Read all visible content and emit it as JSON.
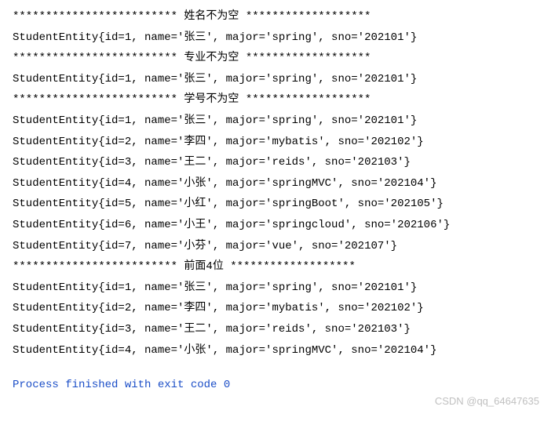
{
  "lines": [
    "*************************  姓名不为空  *******************",
    "StudentEntity{id=1, name='张三', major='spring', sno='202101'}",
    "*************************  专业不为空  *******************",
    "StudentEntity{id=1, name='张三', major='spring', sno='202101'}",
    "*************************  学号不为空  *******************",
    "StudentEntity{id=1, name='张三', major='spring', sno='202101'}",
    "StudentEntity{id=2, name='李四', major='mybatis', sno='202102'}",
    "StudentEntity{id=3, name='王二', major='reids', sno='202103'}",
    "StudentEntity{id=4, name='小张', major='springMVC', sno='202104'}",
    "StudentEntity{id=5, name='小红', major='springBoot', sno='202105'}",
    "StudentEntity{id=6, name='小王', major='springcloud', sno='202106'}",
    "StudentEntity{id=7, name='小芬', major='vue', sno='202107'}",
    "*************************  前面4位  *******************",
    "StudentEntity{id=1, name='张三', major='spring', sno='202101'}",
    "StudentEntity{id=2, name='李四', major='mybatis', sno='202102'}",
    "StudentEntity{id=3, name='王二', major='reids', sno='202103'}",
    "StudentEntity{id=4, name='小张', major='springMVC', sno='202104'}"
  ],
  "process_line": "Process finished with exit code 0",
  "watermark": "CSDN @qq_64647635"
}
